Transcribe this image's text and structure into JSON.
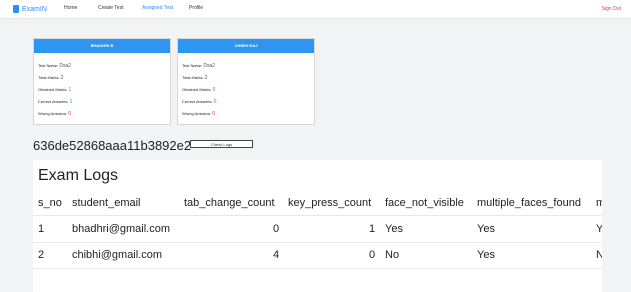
{
  "nav": {
    "brand": "ExamIN",
    "links": [
      "Home",
      "Create Test",
      "Assigned Test",
      "Profile"
    ],
    "active_index": 2,
    "signout": "Sign Out"
  },
  "cards": [
    {
      "header": "BHADHRI B",
      "test_name_label": "Test Name:",
      "test_name": "Dsa2",
      "total_marks_label": "Total Marks:",
      "total_marks": "2",
      "obtained_marks_label": "Obtained Marks:",
      "obtained_marks": "1",
      "correct_answers_label": "Correct Answers:",
      "correct_answers": "1",
      "wrong_answers_label": "Wrong Answers:",
      "wrong_answers": "0"
    },
    {
      "header": "CHIBHI RAJ",
      "test_name_label": "Test Name:",
      "test_name": "Dsa2",
      "total_marks_label": "Total Marks:",
      "total_marks": "2",
      "obtained_marks_label": "Obtained Marks:",
      "obtained_marks": "0",
      "correct_answers_label": "Correct Answers:",
      "correct_answers": "0",
      "wrong_answers_label": "Wrong Answers:",
      "wrong_answers": "0"
    }
  ],
  "test_id": "636de52868aaa11b3892e2",
  "check_logs_button": "Check Logs",
  "logs": {
    "title": "Exam Logs",
    "columns": [
      "s_no",
      "student_email",
      "tab_change_count",
      "key_press_count",
      "face_not_visible",
      "multiple_faces_found",
      "m"
    ],
    "rows": [
      [
        "1",
        "bhadhri@gmail.com",
        "0",
        "1",
        "Yes",
        "Yes",
        "Y"
      ],
      [
        "2",
        "chibhi@gmail.com",
        "4",
        "0",
        "No",
        "Yes",
        "N"
      ]
    ]
  }
}
